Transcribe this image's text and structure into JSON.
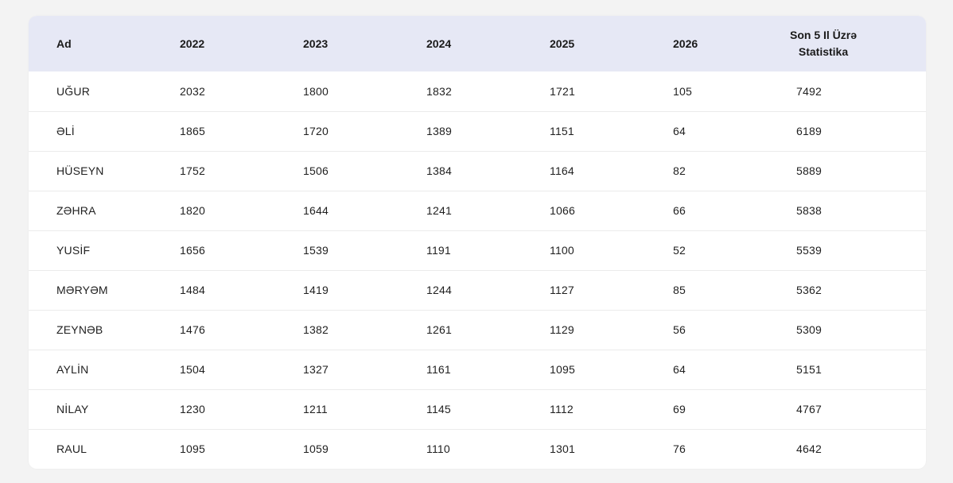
{
  "table": {
    "headers": {
      "name": "Ad",
      "y2022": "2022",
      "y2023": "2023",
      "y2024": "2024",
      "y2025": "2025",
      "y2026": "2026",
      "total_line1": "Son 5 Il Üzrə",
      "total_line2": "Statistika"
    },
    "rows": [
      {
        "name": "UĞUR",
        "y2022": "2032",
        "y2023": "1800",
        "y2024": "1832",
        "y2025": "1721",
        "y2026": "105",
        "total": "7492"
      },
      {
        "name": "ƏLİ",
        "y2022": "1865",
        "y2023": "1720",
        "y2024": "1389",
        "y2025": "1151",
        "y2026": "64",
        "total": "6189"
      },
      {
        "name": "HÜSEYN",
        "y2022": "1752",
        "y2023": "1506",
        "y2024": "1384",
        "y2025": "1164",
        "y2026": "82",
        "total": "5889"
      },
      {
        "name": "ZƏHRA",
        "y2022": "1820",
        "y2023": "1644",
        "y2024": "1241",
        "y2025": "1066",
        "y2026": "66",
        "total": "5838"
      },
      {
        "name": "YUSİF",
        "y2022": "1656",
        "y2023": "1539",
        "y2024": "1191",
        "y2025": "1100",
        "y2026": "52",
        "total": "5539"
      },
      {
        "name": "MƏRYƏM",
        "y2022": "1484",
        "y2023": "1419",
        "y2024": "1244",
        "y2025": "1127",
        "y2026": "85",
        "total": "5362"
      },
      {
        "name": "ZEYNƏB",
        "y2022": "1476",
        "y2023": "1382",
        "y2024": "1261",
        "y2025": "1129",
        "y2026": "56",
        "total": "5309"
      },
      {
        "name": "AYLİN",
        "y2022": "1504",
        "y2023": "1327",
        "y2024": "1161",
        "y2025": "1095",
        "y2026": "64",
        "total": "5151"
      },
      {
        "name": "NİLAY",
        "y2022": "1230",
        "y2023": "1211",
        "y2024": "1145",
        "y2025": "1112",
        "y2026": "69",
        "total": "4767"
      },
      {
        "name": "RAUL",
        "y2022": "1095",
        "y2023": "1059",
        "y2024": "1110",
        "y2025": "1301",
        "y2026": "76",
        "total": "4642"
      }
    ]
  },
  "colors": {
    "header_bg": "#e6e8f5",
    "card_bg": "#ffffff",
    "row_divider": "#ebebeb",
    "page_bg": "#f3f3f3"
  }
}
